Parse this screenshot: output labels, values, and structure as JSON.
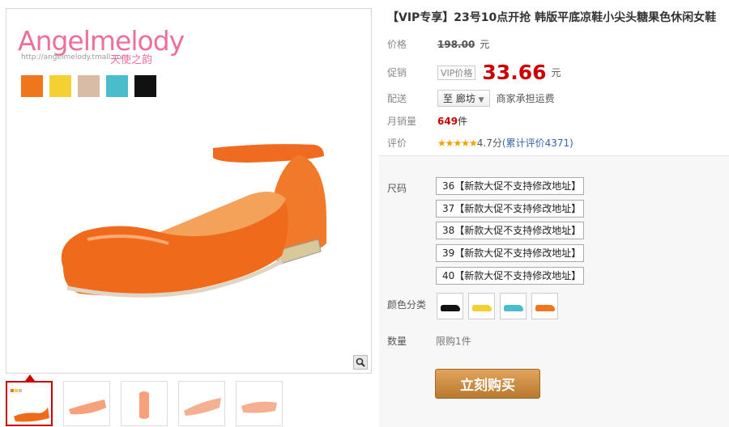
{
  "gallery": {
    "brand": "Angelmelody",
    "brand_url": "http://angelmelody.tmall.com",
    "brand_cn": "天使之韵",
    "swatch_colors": [
      "#f0761e",
      "#f5d033",
      "#d9bca6",
      "#4bbccb",
      "#111111"
    ]
  },
  "product": {
    "title": "【VIP专享】23号10点开抢 韩版平底凉鞋小尖头糖果色休闲女鞋",
    "price_label": "价格",
    "price_original": "198.00",
    "price_unit": "元",
    "promo_label": "促销",
    "vip_tag": "VIP价格",
    "promo_price": "33.66",
    "promo_unit": "元",
    "delivery_label": "配送",
    "delivery_to": "至 廊坊",
    "delivery_note": "商家承担运费",
    "monthly_label": "月销量",
    "monthly_count": "649",
    "monthly_unit": "件",
    "rating_label": "评价",
    "rating_stars": "★★★★★",
    "rating_score": "4.7分",
    "rating_link": "(累计评价4371)"
  },
  "options": {
    "size_label": "尺码",
    "sizes": [
      "36【新款大促不支持修改地址】",
      "37【新款大促不支持修改地址】",
      "38【新款大促不支持修改地址】",
      "39【新款大促不支持修改地址】",
      "40【新款大促不支持修改地址】"
    ],
    "color_label": "颜色分类",
    "colors": [
      "#111111",
      "#f5d033",
      "#4bbccb",
      "#f0761e"
    ],
    "qty_label": "数量",
    "qty_value": "限购1件",
    "buy_label": "立刻购买"
  }
}
